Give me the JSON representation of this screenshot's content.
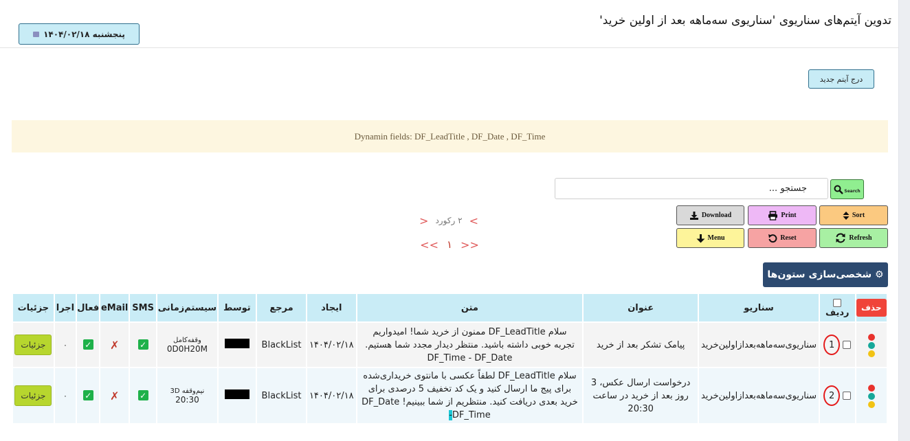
{
  "header": {
    "title": "تدوین آیتم‌های سناریوی 'سناریوی سه‌ماهه بعد از اولین خرید'",
    "date_button": "پنجشنبه ۱۴۰۴/۰۲/۱۸"
  },
  "actions": {
    "new_item": "درج آیتم جدید"
  },
  "dynamic_fields_note": "Dynamin fields: DF_LeadTitle , DF_Date , DF_Time",
  "search": {
    "value": "جستجو ...",
    "button_label": "Search"
  },
  "toolbar": {
    "download": "Download",
    "print": "Print",
    "sort": "Sort",
    "menu": "Menu",
    "reset": "Reset",
    "refresh": "Refresh"
  },
  "pagination": {
    "records": "۲ رکورد",
    "prev": "<",
    "next": ">",
    "first": "<<",
    "last": ">>",
    "current_page": "۱"
  },
  "column_customize": "⚙ شخصی‌سازی ستون‌ها",
  "table": {
    "headers": {
      "delete": "حذف",
      "row": "ردیف",
      "scenario": "سناریو",
      "title": "عنوان",
      "text": "متن",
      "created": "ایجاد",
      "reference": "مرجع",
      "by": "توسط",
      "schedule": "سیستم‌زمانی",
      "sms": "SMS",
      "email": "eMail",
      "active": "فعال",
      "run": "اجرا",
      "details": "جزئیات"
    },
    "rows": [
      {
        "num": "1",
        "scenario": "سناریوی‌سه‌ماهه‌بعدازاولین‌خرید",
        "title": "پیامک تشکر بعد از خرید",
        "text_main": "سلام DF_LeadTitle ممنون از خرید شما! امیدواریم تجربه خوبی داشته باشید. منتظر دیدار مجدد شما هستیم. DF_Time - DF_Date",
        "text_hl": "",
        "text_tail": "",
        "created": "۱۴۰۴/۰۲/۱۸",
        "reference": "BlackList",
        "schedule_top": "وقفه‌کامل",
        "schedule_bot": "0D0H20M",
        "run": "۰",
        "details": "جزئیات"
      },
      {
        "num": "2",
        "scenario": "سناریوی‌سه‌ماهه‌بعدازاولین‌خرید",
        "title": "درخواست ارسال عکس، 3 روز بعد از خرید در ساعت 20:30",
        "text_main": "سلام DF_LeadTitle لطفاً عکسی با مانتوی خریداری‌شده برای پیج ما ارسال کنید و یک کد تخفیف 5 درصدی برای خرید بعدی دریافت کنید. منتظریم از شما ببینیم! DF_Date",
        "text_hl": "-",
        "text_tail": "DF_Time",
        "created": "۱۴۰۴/۰۲/۱۸",
        "reference": "BlackList",
        "schedule_top": "نیم‌وقفه 3D",
        "schedule_bot": "20:30",
        "run": "۰",
        "details": "جزئیات"
      }
    ]
  },
  "colors": {
    "light_blue": "#c8ecf6",
    "navy": "#2d4a70",
    "delete_red": "#f0443a",
    "details_green": "#b7d62e",
    "status_red": "#e8322c",
    "status_teal": "#16a89a",
    "status_yellow": "#f2c314"
  }
}
